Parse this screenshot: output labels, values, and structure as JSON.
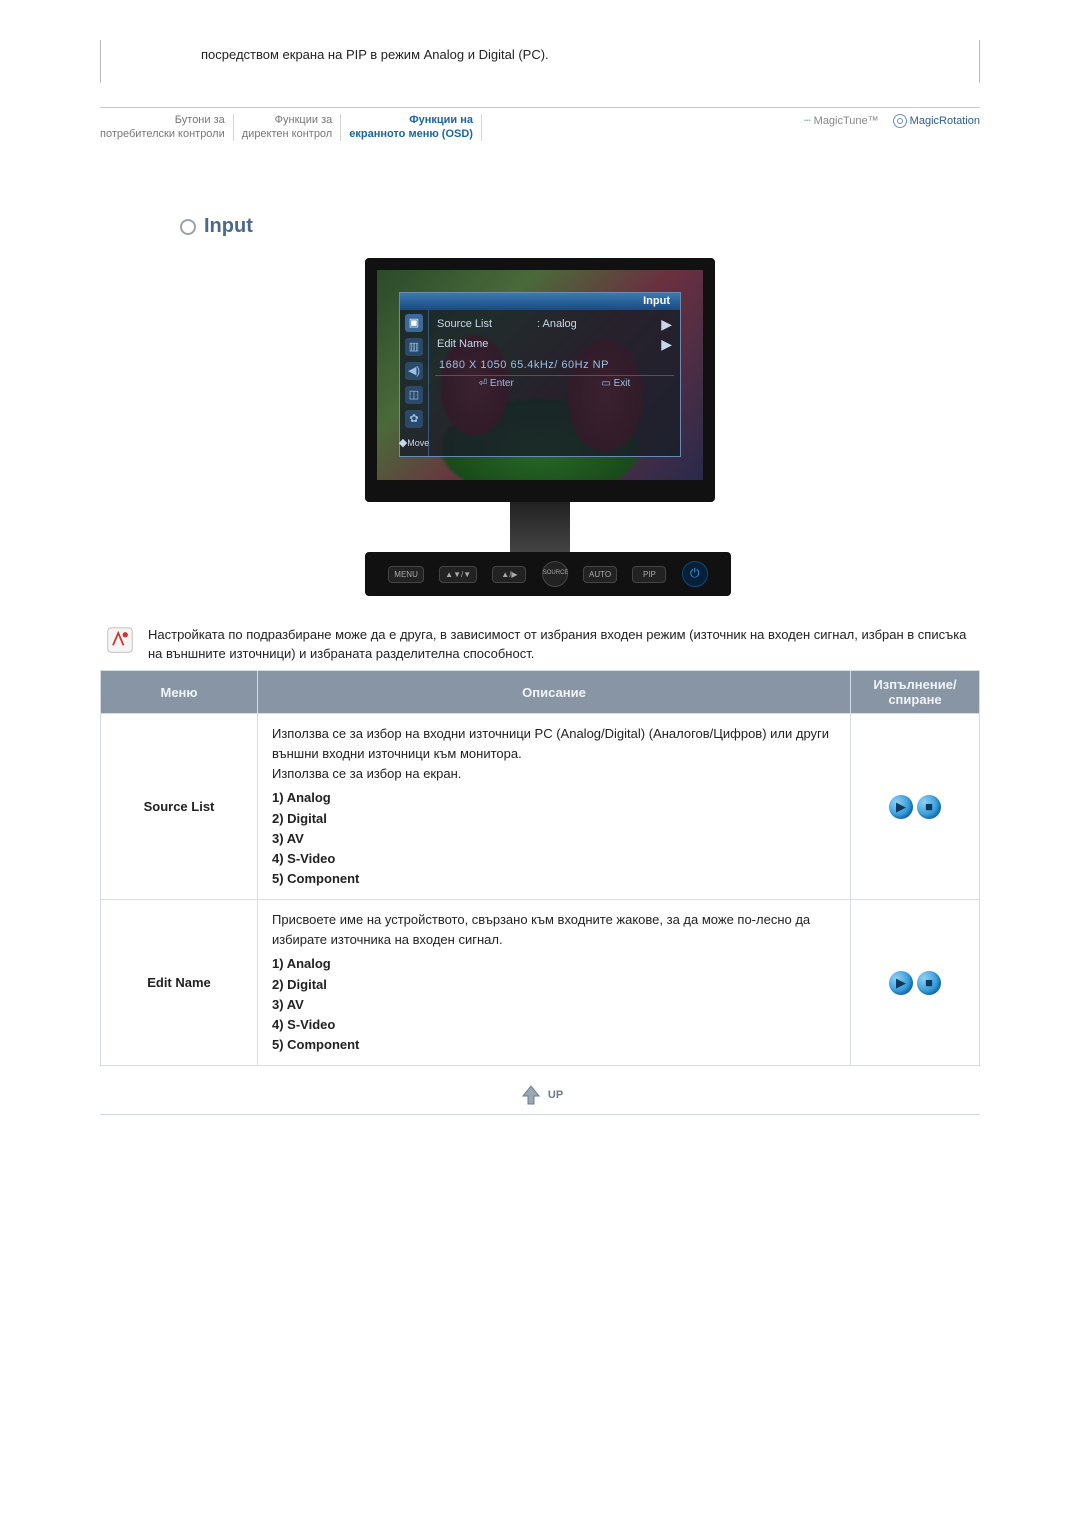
{
  "top_note": "посредством екрана на PIP в режим Analog и Digital (PC).",
  "nav": {
    "c1a": "Бутони за",
    "c1b": "потребителски контроли",
    "c2a": "Функции за",
    "c2b": "директен контрол",
    "c3a": "Функции на",
    "c3b": "екранното меню (OSD)",
    "magic_tune": "MagicTune™",
    "magic_rotation": "MagicRotation"
  },
  "section_title": "Input",
  "osd": {
    "title": "Input",
    "row1_label": "Source List",
    "row1_value": ": Analog",
    "row2_label": "Edit Name",
    "info": "1680 X 1050  65.4kHz/   60Hz  NP",
    "move": "Move",
    "enter": "Enter",
    "exit": "Exit"
  },
  "hw_buttons": {
    "menu": "MENU",
    "bdown": "▲▼/▼",
    "bup": "▲/▶",
    "source": "SOURCE",
    "auto": "AUTO",
    "pip": "PIP",
    "power": "⏻"
  },
  "note": "Настройката по подразбиране може да е друга, в зависимост от избрания входен режим (източник на входен сигнал, избран в списъка на външните източници) и избраната разделителна способност.",
  "table": {
    "h_menu": "Меню",
    "h_desc": "Описание",
    "h_play": "Изпълнение/ спиране",
    "row1": {
      "menu": "Source List",
      "desc": "Използва се за избор на входни източници PC (Analog/Digital) (Аналогов/Цифров) или други външни входни източници към монитора.\nИзползва се за избор на екран.",
      "opts": "1) Analog\n2) Digital\n3) AV\n4) S-Video\n5) Component"
    },
    "row2": {
      "menu": "Edit Name",
      "desc": "Присвоете име на устройството, свързано към входните жакове, за да може по-лесно да избирате източника на входен сигнал.",
      "opts": "1) Analog\n2) Digital\n3) AV\n4) S-Video\n5) Component"
    }
  },
  "up_label": "UP"
}
